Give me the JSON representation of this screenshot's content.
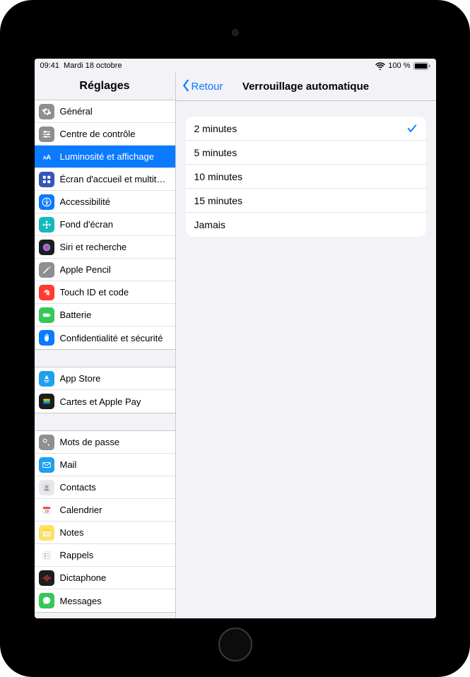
{
  "statusbar": {
    "time": "09:41",
    "date": "Mardi 18 octobre",
    "battery_pct": "100 %",
    "wifi_icon": "wifi-icon",
    "battery_icon": "battery-full-icon"
  },
  "sidebar": {
    "title": "Réglages",
    "groups": [
      {
        "items": [
          {
            "id": "general",
            "label": "Général",
            "icon": "gear-icon",
            "icon_bg": "#8e8e93",
            "selected": false
          },
          {
            "id": "control-center",
            "label": "Centre de contrôle",
            "icon": "sliders-icon",
            "icon_bg": "#8e8e93",
            "selected": false
          },
          {
            "id": "display",
            "label": "Luminosité et affichage",
            "icon": "text-size-icon",
            "icon_bg": "#0a7aff",
            "selected": true
          },
          {
            "id": "home-screen",
            "label": "Écran d'accueil et multitâ…",
            "icon": "grid-icon",
            "icon_bg": "#3755b8",
            "selected": false
          },
          {
            "id": "accessibility",
            "label": "Accessibilité",
            "icon": "accessibility-icon",
            "icon_bg": "#0a7aff",
            "selected": false
          },
          {
            "id": "wallpaper",
            "label": "Fond d'écran",
            "icon": "flower-icon",
            "icon_bg": "#16b8bf",
            "selected": false
          },
          {
            "id": "siri",
            "label": "Siri et recherche",
            "icon": "siri-icon",
            "icon_bg": "#1d1d1f",
            "selected": false
          },
          {
            "id": "apple-pencil",
            "label": "Apple Pencil",
            "icon": "pencil-icon",
            "icon_bg": "#8e8e93",
            "selected": false
          },
          {
            "id": "touch-id",
            "label": "Touch ID et code",
            "icon": "fingerprint-icon",
            "icon_bg": "#ff3b30",
            "selected": false
          },
          {
            "id": "battery",
            "label": "Batterie",
            "icon": "battery-icon",
            "icon_bg": "#34c759",
            "selected": false
          },
          {
            "id": "privacy",
            "label": "Confidentialité et sécurité",
            "icon": "hand-icon",
            "icon_bg": "#0a7aff",
            "selected": false
          }
        ]
      },
      {
        "items": [
          {
            "id": "app-store",
            "label": "App Store",
            "icon": "appstore-icon",
            "icon_bg": "#1e9ff0",
            "selected": false
          },
          {
            "id": "wallet",
            "label": "Cartes et Apple Pay",
            "icon": "wallet-icon",
            "icon_bg": "#1d1d1f",
            "selected": false
          }
        ]
      },
      {
        "items": [
          {
            "id": "passwords",
            "label": "Mots de passe",
            "icon": "key-icon",
            "icon_bg": "#8e8e93",
            "selected": false
          },
          {
            "id": "mail",
            "label": "Mail",
            "icon": "mail-icon",
            "icon_bg": "#1e9ff0",
            "selected": false
          },
          {
            "id": "contacts",
            "label": "Contacts",
            "icon": "contacts-icon",
            "icon_bg": "#e8e8ec",
            "selected": false
          },
          {
            "id": "calendar",
            "label": "Calendrier",
            "icon": "calendar-icon",
            "icon_bg": "#ffffff",
            "selected": false
          },
          {
            "id": "notes",
            "label": "Notes",
            "icon": "notes-icon",
            "icon_bg": "#ffe066",
            "selected": false
          },
          {
            "id": "reminders",
            "label": "Rappels",
            "icon": "reminders-icon",
            "icon_bg": "#ffffff",
            "selected": false
          },
          {
            "id": "voice-memos",
            "label": "Dictaphone",
            "icon": "waveform-icon",
            "icon_bg": "#1d1d1f",
            "selected": false
          },
          {
            "id": "messages",
            "label": "Messages",
            "icon": "messages-icon",
            "icon_bg": "#34c759",
            "selected": false
          }
        ]
      }
    ]
  },
  "detail": {
    "back_label": "Retour",
    "title": "Verrouillage automatique",
    "options": [
      {
        "label": "2 minutes",
        "selected": true
      },
      {
        "label": "5 minutes",
        "selected": false
      },
      {
        "label": "10 minutes",
        "selected": false
      },
      {
        "label": "15 minutes",
        "selected": false
      },
      {
        "label": "Jamais",
        "selected": false
      }
    ]
  },
  "icons_svg": {
    "gear-icon": "<svg viewBox='0 0 24 24' fill='white'><path d='M12 8a4 4 0 100 8 4 4 0 000-8zm9 4a7 7 0 01-.1 1.2l2 1.6-2 3.4-2.4-.8a7 7 0 01-2 .1l-.4 2.5h-4l-.4-2.5a7 7 0 01-2-.1l-2.4.8-2-3.4 2-1.6A7 7 0 013 12a7 7 0 01.1-1.2l-2-1.6 2-3.4 2.4.8a7 7 0 012-.1L8 4h4l.4 2.5a7 7 0 012 .1l2.4-.8 2 3.4-2 1.6A7 7 0 0121 12z'/></svg>",
    "sliders-icon": "<svg viewBox='0 0 24 24' fill='white'><rect x='3' y='5' width='18' height='2' rx='1'/><circle cx='8' cy='6' r='2.5'/><rect x='3' y='11' width='18' height='2' rx='1'/><circle cx='16' cy='12' r='2.5'/><rect x='3' y='17' width='18' height='2' rx='1'/><circle cx='10' cy='18' r='2.5'/></svg>",
    "text-size-icon": "<svg viewBox='0 0 24 24' fill='white'><text x='3' y='18' font-size='12' font-weight='bold' fill='white'>A</text><text x='11' y='18' font-size='16' font-weight='bold' fill='white'>A</text></svg>",
    "grid-icon": "<svg viewBox='0 0 24 24' fill='white'><rect x='3' y='3' width='7' height='7' rx='1.5'/><rect x='14' y='3' width='7' height='7' rx='1.5'/><rect x='3' y='14' width='7' height='7' rx='1.5'/><rect x='14' y='14' width='7' height='7' rx='1.5'/></svg>",
    "accessibility-icon": "<svg viewBox='0 0 24 24' fill='white'><circle cx='12' cy='12' r='10' fill='none' stroke='white' stroke-width='2'/><circle cx='12' cy='6.5' r='1.8'/><path d='M6 9.5l6 1 6-1v1.5l-4 .8v3l2 5h-1.5l-2-4.5-2 4.5H9l2-5v-3l-4-.8z'/></svg>",
    "flower-icon": "<svg viewBox='0 0 24 24' fill='white'><circle cx='12' cy='12' r='3'/><circle cx='12' cy='5' r='2.5' opacity='.85'/><circle cx='12' cy='19' r='2.5' opacity='.85'/><circle cx='5' cy='12' r='2.5' opacity='.85'/><circle cx='19' cy='12' r='2.5' opacity='.85'/></svg>",
    "siri-icon": "<svg viewBox='0 0 24 24'><circle cx='12' cy='12' r='9' fill='url(#sg)'/><defs><radialGradient id='sg'><stop offset='0' stop-color='#6a5acd'/><stop offset='.6' stop-color='#ff3ea5'/><stop offset='1' stop-color='#00d4ff'/></radialGradient></defs></svg>",
    "pencil-icon": "<svg viewBox='0 0 24 24' fill='white'><path d='M3 21l3-1 12-12-2-2L4 18l-1 3zm15-16l2 2 1-1a1.4 1.4 0 00-2-2l-1 1z'/></svg>",
    "fingerprint-icon": "<svg viewBox='0 0 24 24' fill='none' stroke='white' stroke-width='1.5'><path d='M6 12a6 6 0 0112 0c0 4-1 7-1 7M8 12a4 4 0 018 0c0 3-.7 6-.7 6M10 12a2 2 0 014 0c0 2-.4 5-.4 5M12 12v6'/></svg>",
    "battery-icon": "<svg viewBox='0 0 24 24' fill='white'><rect x='3' y='8' width='16' height='8' rx='2'/><rect x='20' y='10' width='2' height='4' rx='1'/></svg>",
    "hand-icon": "<svg viewBox='0 0 24 24' fill='white'><path d='M12 2l-1 1v6h-1V4l-1 1v5H8V6L7 7v7c0 4 2 7 5 7s5-3 5-7V5l-1-1v5h-1V3l-1-1v6h-1V2z'/></svg>",
    "appstore-icon": "<svg viewBox='0 0 24 24' fill='white'><path d='M12 3l5 9H7l5-9zm-6 12h12l1 2H5l1-2zm2 4h8l1 2H7l1-2z'/></svg>",
    "wallet-icon": "<svg viewBox='0 0 24 24'><rect x='4' y='6' width='16' height='4' rx='1' fill='#ffcc00'/><rect x='4' y='10' width='16' height='4' rx='1' fill='#34c759'/><rect x='4' y='14' width='16' height='4' rx='1' fill='#0a7aff'/></svg>",
    "key-icon": "<svg viewBox='0 0 24 24' fill='white'><circle cx='8' cy='8' r='4' fill='none' stroke='white' stroke-width='2'/><path d='M11 11l8 8-2 2-2-2 1-1-2-2 1-1-3-3z'/></svg>",
    "mail-icon": "<svg viewBox='0 0 24 24' fill='white'><rect x='3' y='6' width='18' height='12' rx='2' fill='none' stroke='white' stroke-width='1.6'/><path d='M4 7l8 6 8-6' fill='none' stroke='white' stroke-width='1.6'/></svg>",
    "contacts-icon": "<svg viewBox='0 0 24 24'><rect x='3' y='3' width='18' height='18' rx='3' fill='#d9d9de'/><circle cx='12' cy='10' r='3' fill='#8e8e93'/><path d='M6 19c1-3 4-4 6-4s5 1 6 4' fill='#8e8e93'/></svg>",
    "calendar-icon": "<svg viewBox='0 0 24 24'><rect x='3' y='4' width='18' height='17' rx='3' fill='white' stroke='#d0d0d4'/><rect x='3' y='4' width='18' height='5' rx='3' fill='#ff3b30'/><text x='12' y='18' font-size='9' text-anchor='middle' fill='#333'>18</text></svg>",
    "notes-icon": "<svg viewBox='0 0 24 24'><rect x='3' y='3' width='18' height='18' rx='3' fill='#fff8d6'/><rect x='3' y='3' width='18' height='5' rx='3' fill='#ffd60a'/><line x1='6' y1='12' x2='18' y2='12' stroke='#c9c28a'/><line x1='6' y1='16' x2='18' y2='16' stroke='#c9c28a'/></svg>",
    "reminders-icon": "<svg viewBox='0 0 24 24'><rect x='3' y='3' width='18' height='18' rx='3' fill='white' stroke='#d0d0d4'/><circle cx='8' cy='8' r='1.5' fill='#ff3b30'/><line x1='11' y1='8' x2='19' y2='8' stroke='#999'/><circle cx='8' cy='13' r='1.5' fill='#0a7aff'/><line x1='11' y1='13' x2='19' y2='13' stroke='#999'/><circle cx='8' cy='18' r='1.5' fill='#ff9500'/><line x1='11' y1='18' x2='19' y2='18' stroke='#999'/></svg>",
    "waveform-icon": "<svg viewBox='0 0 24 24' fill='#ff3b30'><rect x='4' y='10' width='2' height='4'/><rect x='8' y='7' width='2' height='10'/><rect x='12' y='4' width='2' height='16'/><rect x='16' y='8' width='2' height='8'/><rect x='20' y='10' width='2' height='4'/></svg>",
    "messages-icon": "<svg viewBox='0 0 24 24' fill='white'><path d='M12 3C7 3 3 6.5 3 11c0 2.4 1.2 4.5 3 6l-1 4 4-2c1 .3 2 .5 3 .5 5 0 9-3.5 9-8S17 3 12 3z'/></svg>",
    "chevron-left-icon": "<svg viewBox='0 0 12 20' fill='none' stroke='#0a7aff' stroke-width='2.5' stroke-linecap='round' stroke-linejoin='round'><polyline points='9,2 3,10 9,18'/></svg>",
    "check-icon": "<svg viewBox='0 0 24 24' fill='none' stroke='#0a7aff' stroke-width='2.8' stroke-linecap='round' stroke-linejoin='round'><polyline points='4,12 9,18 20,5'/></svg>",
    "wifi-status-icon": "<svg width='14' height='11' viewBox='0 0 16 12' fill='black'><path d='M8 10.5a1.2 1.2 0 100 2.4 1.2 1.2 0 000-2.4zM4.5 8a5 5 0 017 0l-1.2 1.2a3.3 3.3 0 00-4.6 0L4.5 8zm-2.3-2.3a8.3 8.3 0 0111.6 0L12.6 7a6.6 6.6 0 00-9.2 0L2.2 5.7zM0 3.4a11.5 11.5 0 0116 0l-1.2 1.2a9.8 9.8 0 00-13.6 0L0 3.4z'/></svg>",
    "battery-status-icon": "<svg width='24' height='11' viewBox='0 0 26 12'><rect x='0.5' y='0.5' width='22' height='11' rx='2.5' fill='none' stroke='black' stroke-opacity='.4'/><rect x='2' y='2' width='19' height='8' rx='1.3' fill='black'/><rect x='24' y='4' width='1.5' height='4' rx='.8' fill='black' fill-opacity='.5'/></svg>"
  }
}
